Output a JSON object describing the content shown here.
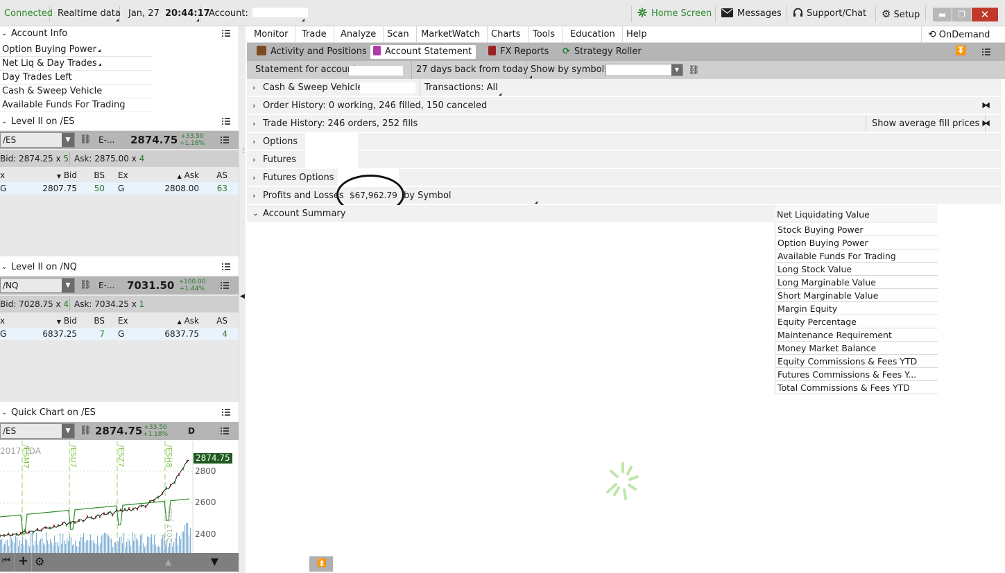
{
  "topbar": {
    "connected": "Connected",
    "realtime": "Realtime data",
    "date": "Jan, 27",
    "time": "20:44:17",
    "account_label": "Account:",
    "home_screen": "Home Screen",
    "messages": "Messages",
    "support": "Support/Chat",
    "setup": "Setup"
  },
  "account_info": {
    "title": "Account Info",
    "items": [
      "Option Buying Power",
      "Net Liq & Day Trades",
      "Day Trades Left",
      "Cash & Sweep Vehicle",
      "Available Funds For Trading"
    ]
  },
  "level2_es": {
    "title": "Level II on /ES",
    "symbol": "/ES",
    "desc": "E-...",
    "price": "2874.75",
    "change": "+33.50",
    "change_pct": "+1.18%",
    "bid_label": "Bid:",
    "bid": "2874.25",
    "bid_x": "x",
    "bid_size": "5",
    "ask_label": "Ask:",
    "ask": "2875.00",
    "ask_x": "x",
    "ask_size": "4",
    "headers": [
      "x",
      "Bid",
      "BS",
      "Ex",
      "Ask",
      "AS"
    ],
    "row": [
      "G",
      "2807.75",
      "50",
      "G",
      "2808.00",
      "63"
    ]
  },
  "level2_nq": {
    "title": "Level II on /NQ",
    "symbol": "/NQ",
    "desc": "E-...",
    "price": "7031.50",
    "change": "+100.00",
    "change_pct": "+1.44%",
    "bid_label": "Bid:",
    "bid": "7028.75",
    "bid_x": "x",
    "bid_size": "4",
    "ask_label": "Ask:",
    "ask": "7034.25",
    "ask_x": "x",
    "ask_size": "1",
    "headers": [
      "x",
      "Bid",
      "BS",
      "Ex",
      "Ask",
      "AS"
    ],
    "row": [
      "G",
      "6837.25",
      "7",
      "G",
      "6837.75",
      "4"
    ]
  },
  "quick_chart": {
    "title": "Quick Chart on /ES",
    "symbol": "/ES",
    "price": "2874.75",
    "change": "+33.50",
    "change_pct": "+1.18%",
    "period": "D",
    "watermark": "2017 TDA",
    "contracts": [
      "/ESM7",
      "/ESU7",
      "/ESZ7",
      "/ESH8"
    ],
    "vertical_label": "2017 year",
    "last_price_tag": "2874.75",
    "yticks": [
      "2800",
      "2600",
      "2400"
    ]
  },
  "nav": {
    "tabs": [
      "Monitor",
      "Trade",
      "Analyze",
      "Scan",
      "MarketWatch",
      "Charts",
      "Tools",
      "Education",
      "Help"
    ],
    "ondemand": "OnDemand"
  },
  "subtabs": [
    "Activity and Positions",
    "Account Statement",
    "FX Reports",
    "Strategy Roller"
  ],
  "statement": {
    "for_account": "Statement for account",
    "range": "27 days back from today",
    "by_symbol": "Show by symbol:"
  },
  "rows": {
    "cash": "Cash & Sweep Vehicle",
    "transactions": "Transactions: All",
    "order_history": "Order History: 0 working, 246 filled, 150 canceled",
    "trade_history": "Trade History: 246 orders, 252 fills",
    "avg_fill": "Show average fill prices",
    "options": "Options",
    "futures": "Futures",
    "futures_options": "Futures Options",
    "pnl": "Profits and Losses",
    "pnl_value": "$67,962.79",
    "pnl_by": "by Symbol",
    "summary": "Account Summary"
  },
  "summary_items": [
    "Net Liquidating Value",
    "Stock Buying Power",
    "Option Buying Power",
    "Available Funds For Trading",
    "Long Stock Value",
    "Long Marginable Value",
    "Short Marginable Value",
    "Margin Equity",
    "Equity Percentage",
    "Maintenance Requirement",
    "Money Market Balance",
    "Equity Commissions & Fees YTD",
    "Futures Commissions & Fees Y...",
    "Total Commissions & Fees YTD"
  ],
  "colors": {
    "connected": "#2c8a2c",
    "up": "#2a7a2a",
    "price_tag": "#1e5a1e"
  }
}
